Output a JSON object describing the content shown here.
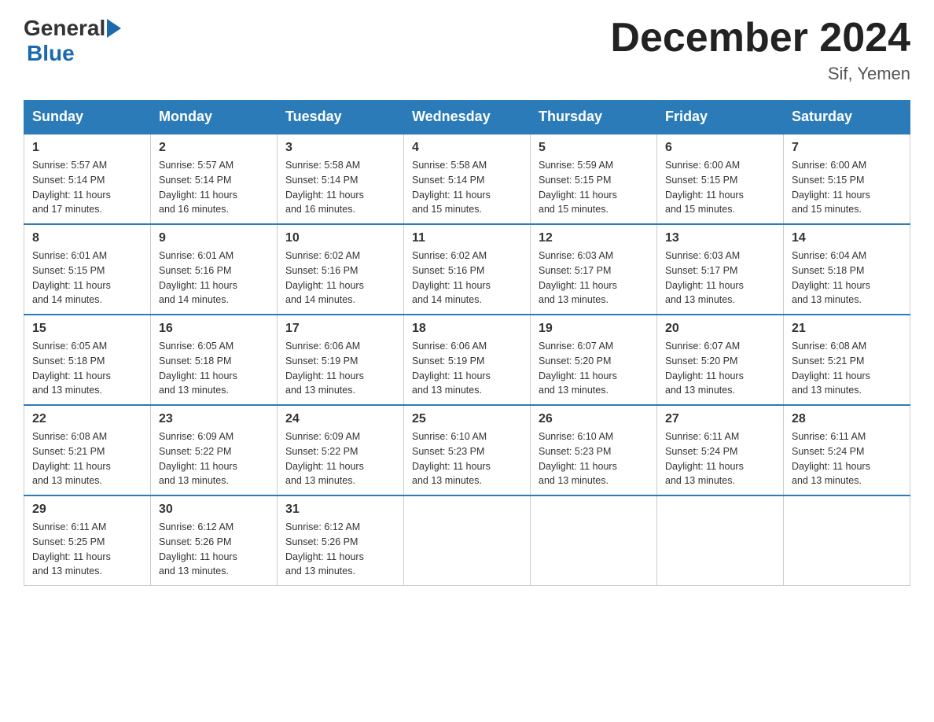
{
  "logo": {
    "general": "General",
    "blue": "Blue"
  },
  "title": "December 2024",
  "subtitle": "Sif, Yemen",
  "days": [
    "Sunday",
    "Monday",
    "Tuesday",
    "Wednesday",
    "Thursday",
    "Friday",
    "Saturday"
  ],
  "weeks": [
    [
      {
        "day": "1",
        "sunrise": "5:57 AM",
        "sunset": "5:14 PM",
        "daylight": "11 hours and 17 minutes."
      },
      {
        "day": "2",
        "sunrise": "5:57 AM",
        "sunset": "5:14 PM",
        "daylight": "11 hours and 16 minutes."
      },
      {
        "day": "3",
        "sunrise": "5:58 AM",
        "sunset": "5:14 PM",
        "daylight": "11 hours and 16 minutes."
      },
      {
        "day": "4",
        "sunrise": "5:58 AM",
        "sunset": "5:14 PM",
        "daylight": "11 hours and 15 minutes."
      },
      {
        "day": "5",
        "sunrise": "5:59 AM",
        "sunset": "5:15 PM",
        "daylight": "11 hours and 15 minutes."
      },
      {
        "day": "6",
        "sunrise": "6:00 AM",
        "sunset": "5:15 PM",
        "daylight": "11 hours and 15 minutes."
      },
      {
        "day": "7",
        "sunrise": "6:00 AM",
        "sunset": "5:15 PM",
        "daylight": "11 hours and 15 minutes."
      }
    ],
    [
      {
        "day": "8",
        "sunrise": "6:01 AM",
        "sunset": "5:15 PM",
        "daylight": "11 hours and 14 minutes."
      },
      {
        "day": "9",
        "sunrise": "6:01 AM",
        "sunset": "5:16 PM",
        "daylight": "11 hours and 14 minutes."
      },
      {
        "day": "10",
        "sunrise": "6:02 AM",
        "sunset": "5:16 PM",
        "daylight": "11 hours and 14 minutes."
      },
      {
        "day": "11",
        "sunrise": "6:02 AM",
        "sunset": "5:16 PM",
        "daylight": "11 hours and 14 minutes."
      },
      {
        "day": "12",
        "sunrise": "6:03 AM",
        "sunset": "5:17 PM",
        "daylight": "11 hours and 13 minutes."
      },
      {
        "day": "13",
        "sunrise": "6:03 AM",
        "sunset": "5:17 PM",
        "daylight": "11 hours and 13 minutes."
      },
      {
        "day": "14",
        "sunrise": "6:04 AM",
        "sunset": "5:18 PM",
        "daylight": "11 hours and 13 minutes."
      }
    ],
    [
      {
        "day": "15",
        "sunrise": "6:05 AM",
        "sunset": "5:18 PM",
        "daylight": "11 hours and 13 minutes."
      },
      {
        "day": "16",
        "sunrise": "6:05 AM",
        "sunset": "5:18 PM",
        "daylight": "11 hours and 13 minutes."
      },
      {
        "day": "17",
        "sunrise": "6:06 AM",
        "sunset": "5:19 PM",
        "daylight": "11 hours and 13 minutes."
      },
      {
        "day": "18",
        "sunrise": "6:06 AM",
        "sunset": "5:19 PM",
        "daylight": "11 hours and 13 minutes."
      },
      {
        "day": "19",
        "sunrise": "6:07 AM",
        "sunset": "5:20 PM",
        "daylight": "11 hours and 13 minutes."
      },
      {
        "day": "20",
        "sunrise": "6:07 AM",
        "sunset": "5:20 PM",
        "daylight": "11 hours and 13 minutes."
      },
      {
        "day": "21",
        "sunrise": "6:08 AM",
        "sunset": "5:21 PM",
        "daylight": "11 hours and 13 minutes."
      }
    ],
    [
      {
        "day": "22",
        "sunrise": "6:08 AM",
        "sunset": "5:21 PM",
        "daylight": "11 hours and 13 minutes."
      },
      {
        "day": "23",
        "sunrise": "6:09 AM",
        "sunset": "5:22 PM",
        "daylight": "11 hours and 13 minutes."
      },
      {
        "day": "24",
        "sunrise": "6:09 AM",
        "sunset": "5:22 PM",
        "daylight": "11 hours and 13 minutes."
      },
      {
        "day": "25",
        "sunrise": "6:10 AM",
        "sunset": "5:23 PM",
        "daylight": "11 hours and 13 minutes."
      },
      {
        "day": "26",
        "sunrise": "6:10 AM",
        "sunset": "5:23 PM",
        "daylight": "11 hours and 13 minutes."
      },
      {
        "day": "27",
        "sunrise": "6:11 AM",
        "sunset": "5:24 PM",
        "daylight": "11 hours and 13 minutes."
      },
      {
        "day": "28",
        "sunrise": "6:11 AM",
        "sunset": "5:24 PM",
        "daylight": "11 hours and 13 minutes."
      }
    ],
    [
      {
        "day": "29",
        "sunrise": "6:11 AM",
        "sunset": "5:25 PM",
        "daylight": "11 hours and 13 minutes."
      },
      {
        "day": "30",
        "sunrise": "6:12 AM",
        "sunset": "5:26 PM",
        "daylight": "11 hours and 13 minutes."
      },
      {
        "day": "31",
        "sunrise": "6:12 AM",
        "sunset": "5:26 PM",
        "daylight": "11 hours and 13 minutes."
      },
      null,
      null,
      null,
      null
    ]
  ],
  "labels": {
    "sunrise": "Sunrise:",
    "sunset": "Sunset:",
    "daylight": "Daylight:"
  }
}
